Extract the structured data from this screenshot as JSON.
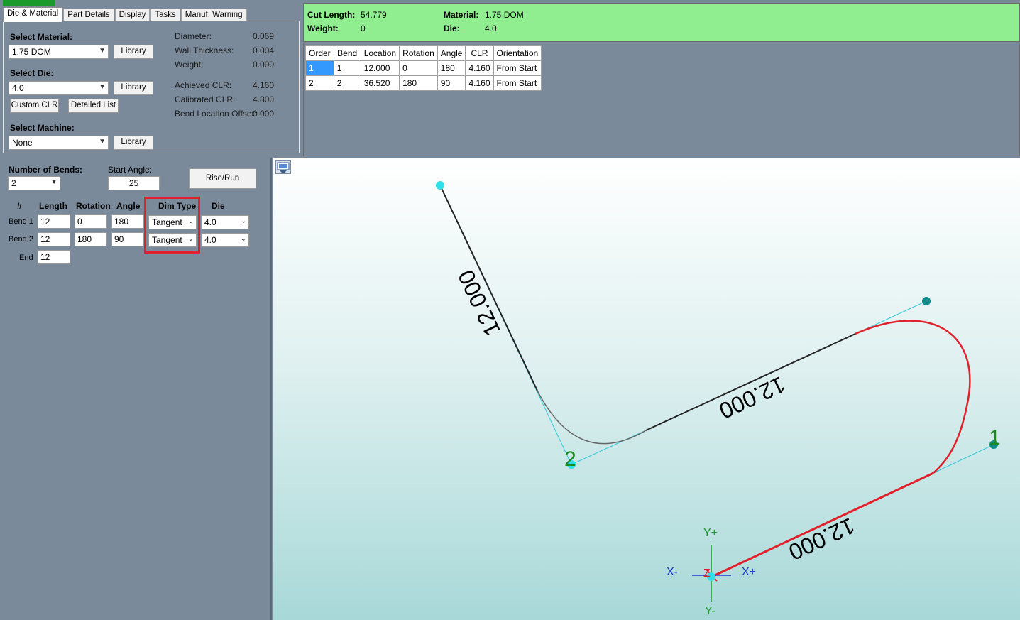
{
  "tabs": [
    "Die & Material",
    "Part Details",
    "Display",
    "Tasks",
    "Manuf. Warning"
  ],
  "die_material": {
    "select_material_label": "Select Material:",
    "material_value": "1.75 DOM",
    "select_die_label": "Select Die:",
    "die_value": "4.0",
    "select_machine_label": "Select Machine:",
    "machine_value": "None",
    "library_label": "Library",
    "custom_clr_label": "Custom CLR",
    "detailed_list_label": "Detailed List",
    "props": [
      {
        "label": "Diameter:",
        "value": "0.069"
      },
      {
        "label": "Wall Thickness:",
        "value": "0.004"
      },
      {
        "label": "Weight:",
        "value": "0.000"
      },
      {
        "label": "Achieved CLR:",
        "value": "4.160"
      },
      {
        "label": "Calibrated CLR:",
        "value": "4.800"
      },
      {
        "label": "Bend Location Offset:",
        "value": "0.000"
      }
    ]
  },
  "summary": {
    "cut_length_label": "Cut Length:",
    "cut_length_value": "54.779",
    "weight_label": "Weight:",
    "weight_value": "0",
    "material_label": "Material:",
    "material_value": "1.75 DOM",
    "die_label": "Die:",
    "die_value": "4.0",
    "accent_color": "#90ee90"
  },
  "bend_table": {
    "columns": [
      "Order",
      "Bend",
      "Location",
      "Rotation",
      "Angle",
      "CLR",
      "Orientation"
    ],
    "rows": [
      [
        "1",
        "1",
        "12.000",
        "0",
        "180",
        "4.160",
        "From Start"
      ],
      [
        "2",
        "2",
        "36.520",
        "180",
        "90",
        "4.160",
        "From Start"
      ]
    ]
  },
  "bend_editor": {
    "num_bends_label": "Number of Bends:",
    "num_bends_value": "2",
    "start_angle_label": "Start Angle:",
    "start_angle_value": "25",
    "rise_run_label": "Rise/Run",
    "columns": [
      "#",
      "Length",
      "Rotation",
      "Angle",
      "Dim Type",
      "Die"
    ],
    "rows": [
      {
        "label": "Bend 1",
        "length": "12",
        "rotation": "0",
        "angle": "180",
        "dim_type": "Tangent",
        "die": "4.0"
      },
      {
        "label": "Bend 2",
        "length": "12",
        "rotation": "180",
        "angle": "90",
        "dim_type": "Tangent",
        "die": "4.0"
      }
    ],
    "end_label": "End",
    "end_length": "12",
    "highlight_color": "#e0202a"
  },
  "viewport": {
    "segment_labels": [
      "12.000",
      "12.000",
      "12.000"
    ],
    "bend_labels": [
      "2",
      "1"
    ],
    "axis_labels": {
      "y_plus": "Y+",
      "y_minus": "Y-",
      "x_minus": "X-",
      "x_plus": "X+",
      "z": "Z"
    },
    "tube_color": "#e0202a",
    "preview_color": "#222222",
    "tangent_color": "#30c8d8",
    "icon": "view-reset-icon"
  }
}
